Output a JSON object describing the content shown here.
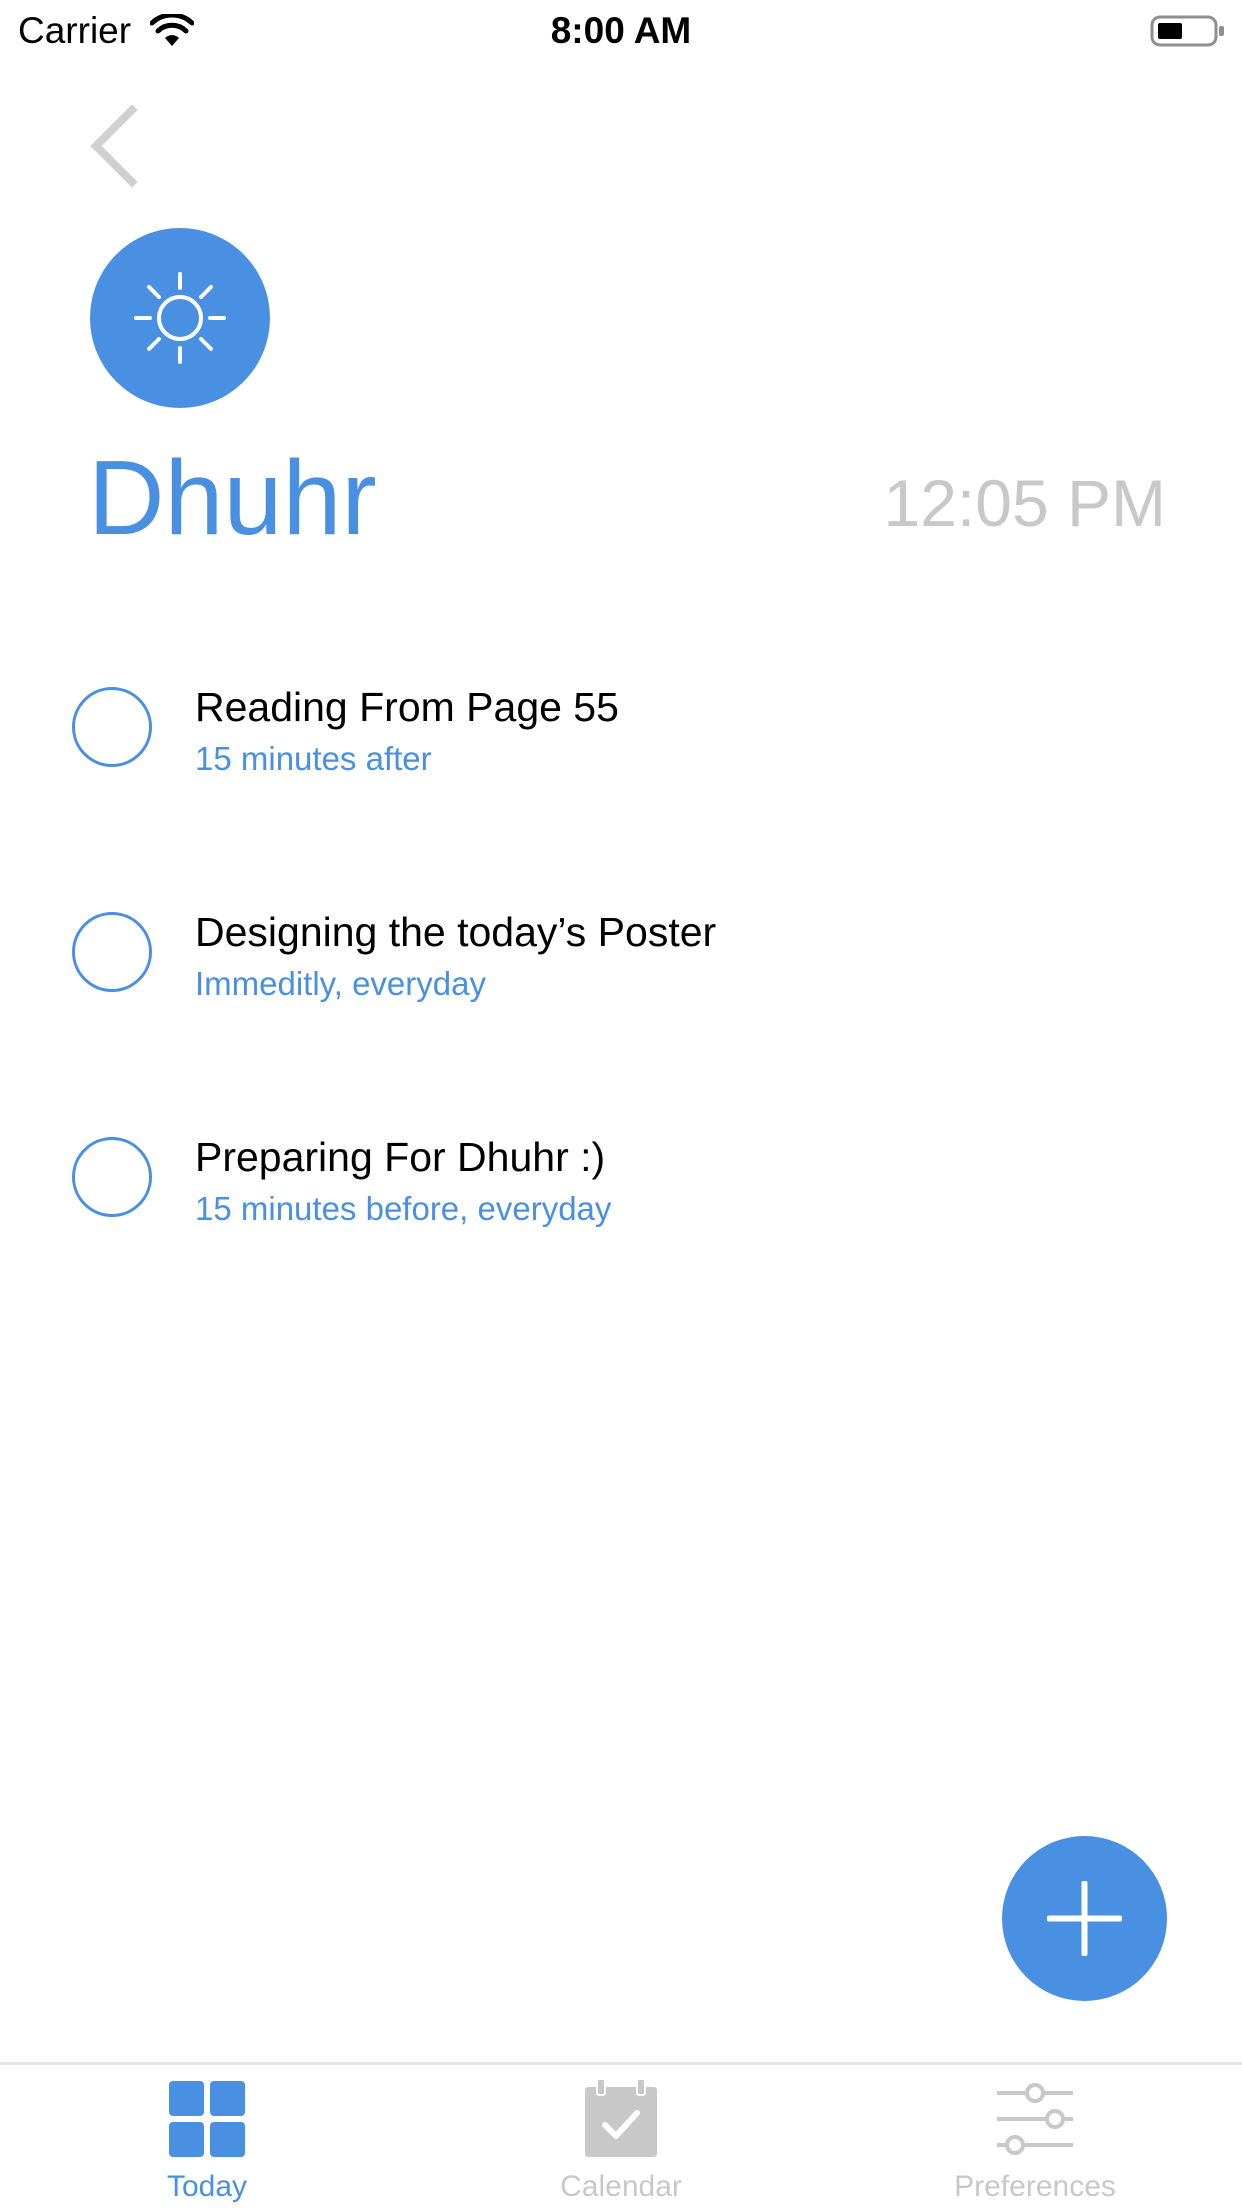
{
  "status_bar": {
    "carrier": "Carrier",
    "time": "8:00 AM"
  },
  "prayer": {
    "icon": "sun-icon",
    "name": "Dhuhr",
    "time": "12:05 PM"
  },
  "tasks": [
    {
      "title": "Reading From Page 55",
      "subtitle": "15 minutes after"
    },
    {
      "title": "Designing the today’s Poster",
      "subtitle": "Immeditly, everyday"
    },
    {
      "title": "Preparing For Dhuhr :)",
      "subtitle": "15 minutes before, everyday"
    }
  ],
  "tab_bar": {
    "today": "Today",
    "calendar": "Calendar",
    "preferences": "Preferences"
  },
  "colors": {
    "accent": "#4A90E2",
    "muted": "#C8C8C8",
    "text": "#000000"
  }
}
